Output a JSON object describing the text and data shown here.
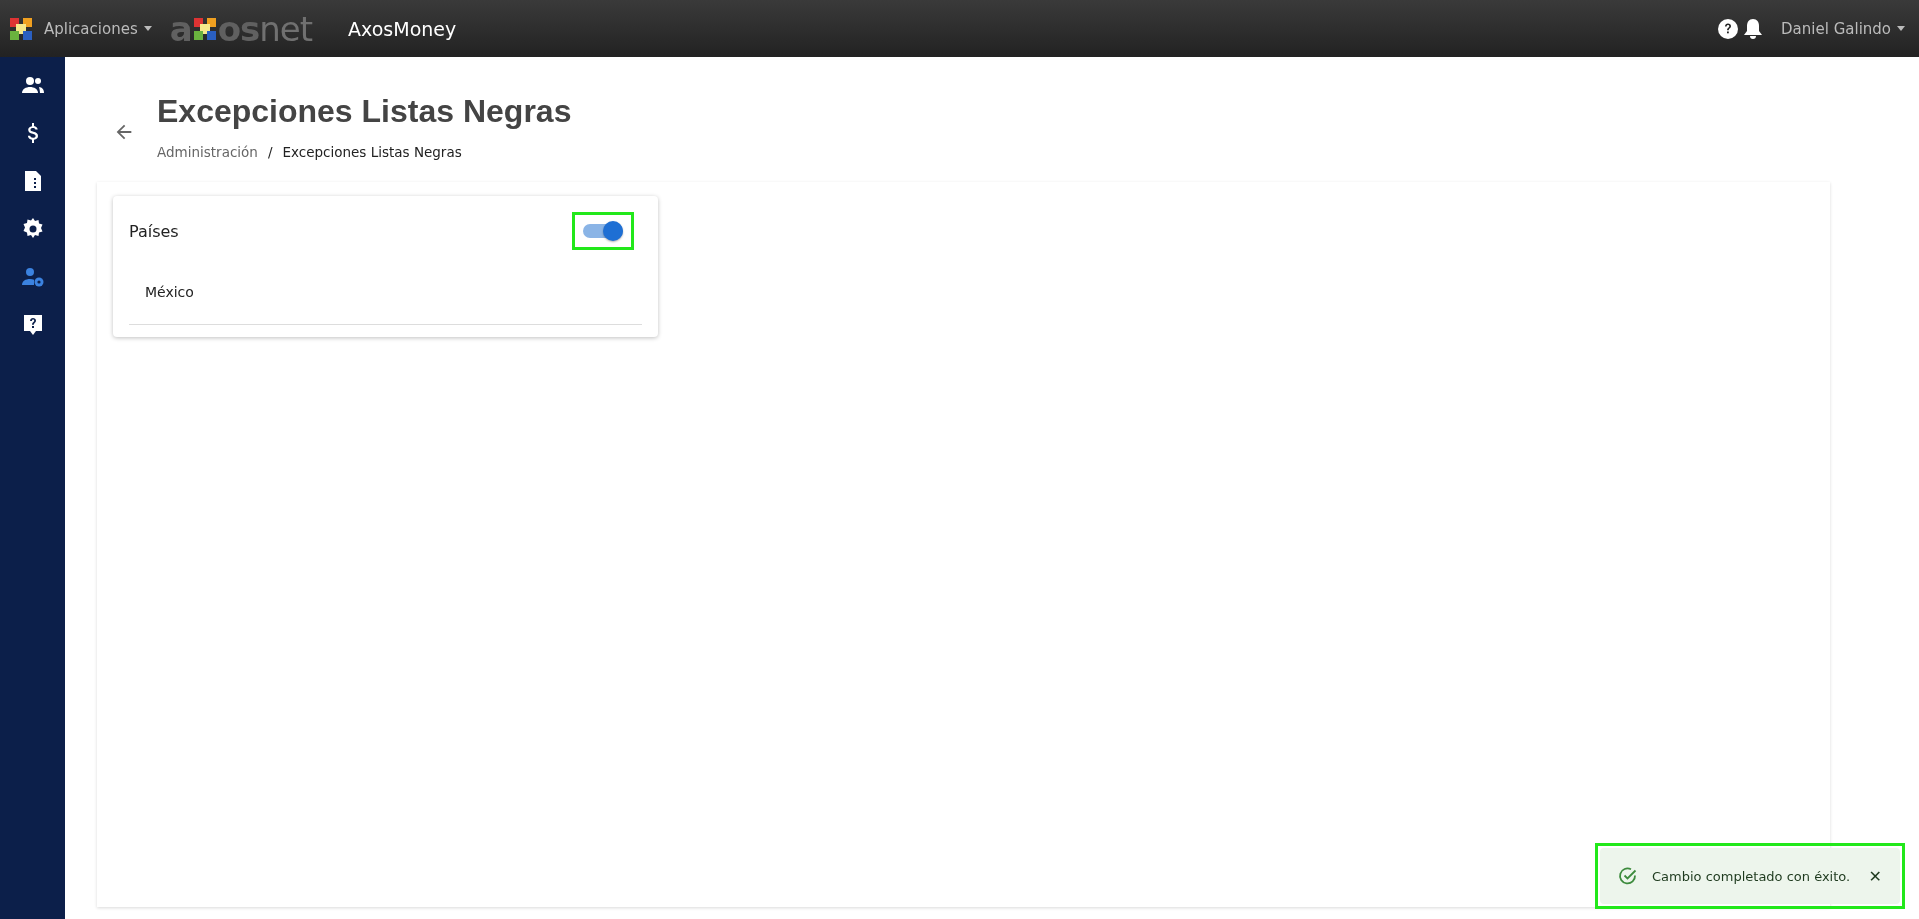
{
  "top_bar": {
    "apps_menu": "Aplicaciones",
    "brand_logo": {
      "prefix": "a",
      "middle": "os",
      "suffix": "net"
    },
    "app_name": "AxosMoney",
    "user_menu": "Daniel Galindo"
  },
  "sidebar": {
    "items": [
      {
        "kind": "people",
        "selected": false
      },
      {
        "kind": "dollar",
        "selected": false
      },
      {
        "kind": "document",
        "selected": false
      },
      {
        "kind": "gear",
        "selected": false
      },
      {
        "kind": "user-gear",
        "selected": true
      },
      {
        "kind": "help",
        "selected": false
      }
    ]
  },
  "page": {
    "title": "Excepciones Listas Negras",
    "breadcrumb": [
      "Administración",
      "Excepciones Listas Negras"
    ],
    "breadcrumb_separator": "/"
  },
  "card": {
    "title": "Países",
    "toggle": {
      "on": true,
      "highlighted": true
    },
    "items": [
      "México"
    ]
  },
  "toast": {
    "message": "Cambio completado con éxito.",
    "close": "✕",
    "highlighted": true
  }
}
